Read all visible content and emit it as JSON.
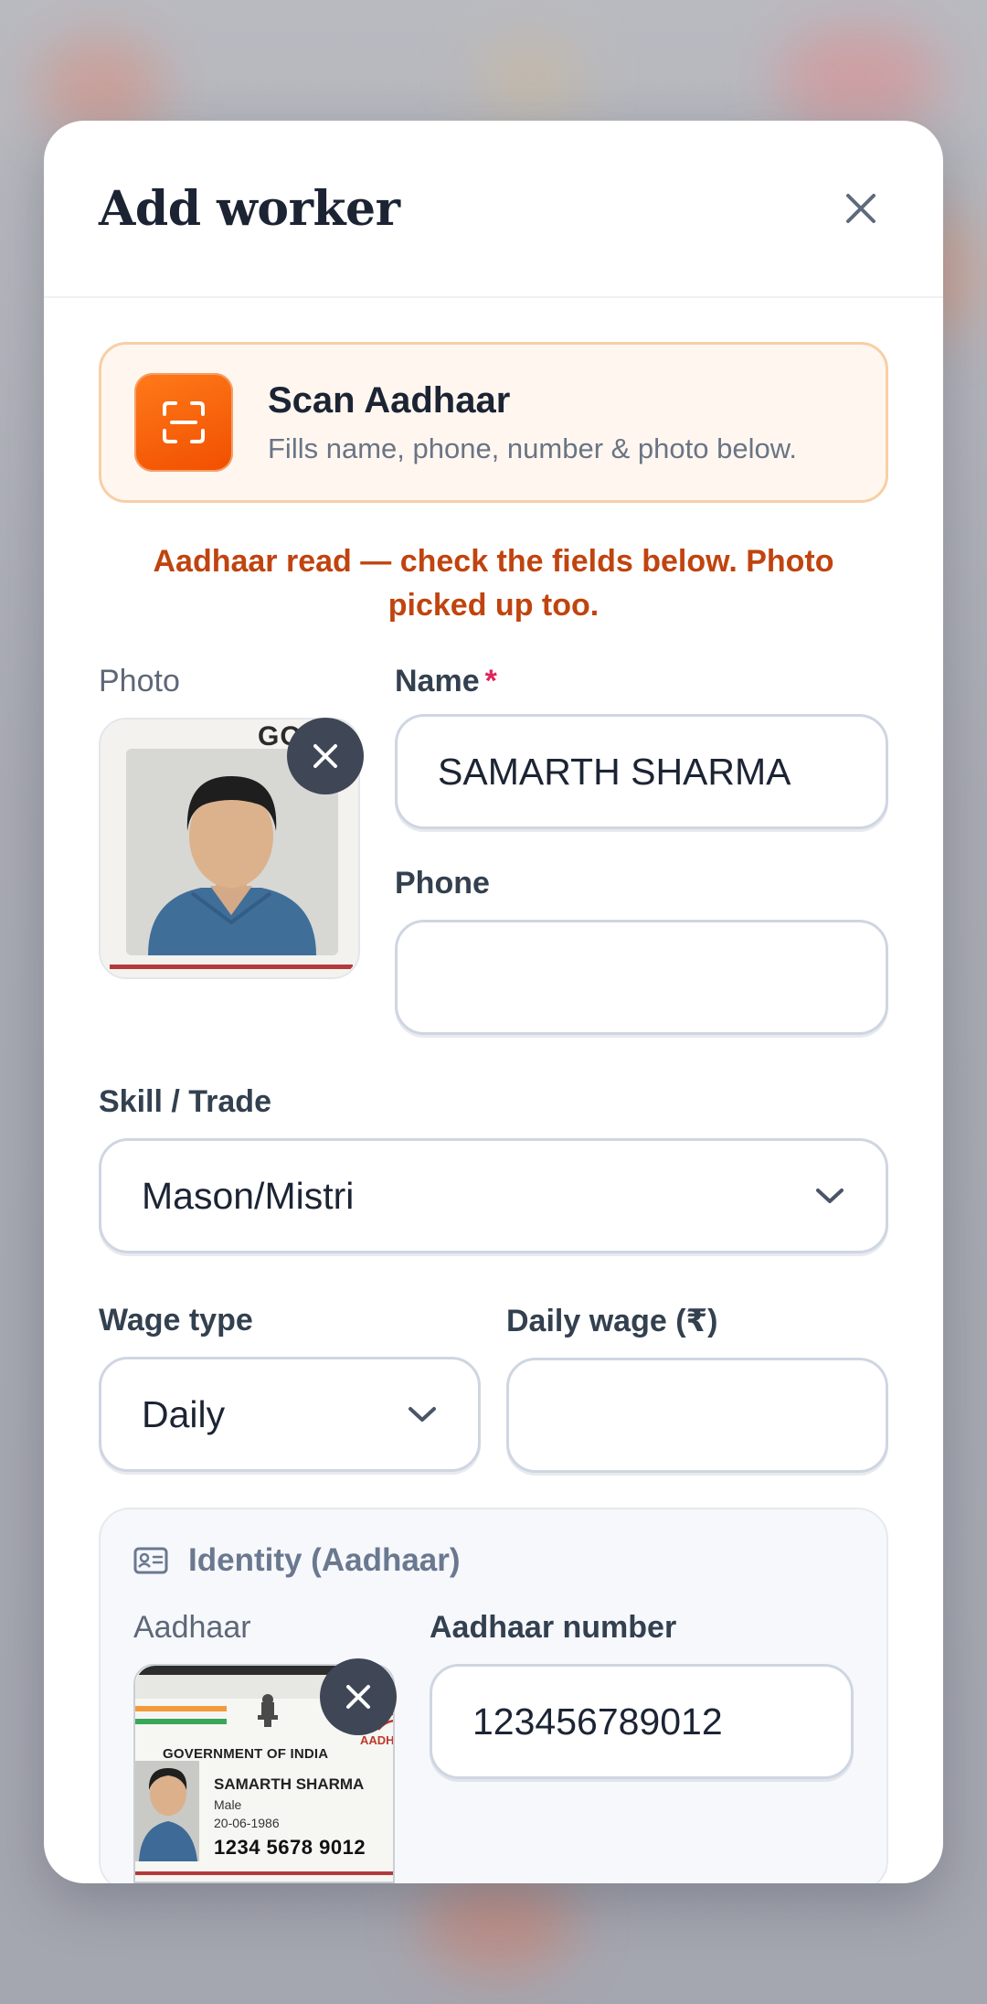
{
  "modal": {
    "title": "Add worker"
  },
  "scan": {
    "title": "Scan Aadhaar",
    "subtitle": "Fills name, phone, number & photo below."
  },
  "notice": "Aadhaar read — check the fields below. Photo picked up too.",
  "photo": {
    "label": "Photo",
    "corner_text": "GO"
  },
  "name": {
    "label": "Name",
    "required_mark": "*",
    "value": "SAMARTH SHARMA"
  },
  "phone": {
    "label": "Phone",
    "value": ""
  },
  "skill": {
    "label": "Skill / Trade",
    "value": "Mason/Mistri"
  },
  "wage_type": {
    "label": "Wage type",
    "value": "Daily"
  },
  "daily_wage": {
    "label": "Daily wage (₹)",
    "value": ""
  },
  "identity": {
    "heading": "Identity (Aadhaar)",
    "image_label": "Aadhaar",
    "number_label": "Aadhaar number",
    "number_value": "123456789012",
    "card": {
      "gov_text": "GOVERNMENT OF INDIA",
      "brand_fragment": "AADH",
      "holder_name": "SAMARTH SHARMA",
      "gender": "Male",
      "dob": "20-06-1986",
      "number": "1234 5678 9012"
    }
  },
  "colors": {
    "accent": "#f25a06",
    "notice": "#c0440f",
    "required": "#e0245e",
    "heading": "#1c2434"
  }
}
